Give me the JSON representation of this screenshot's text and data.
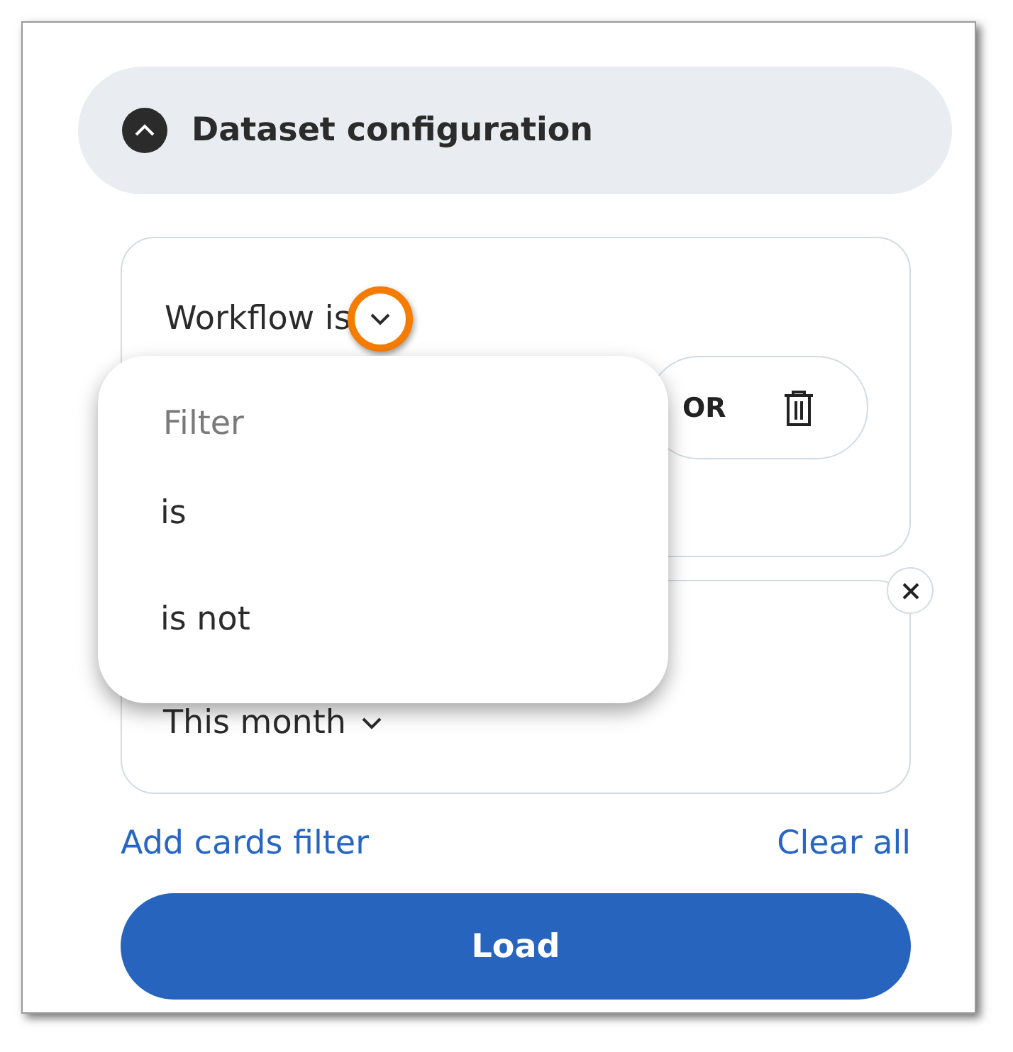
{
  "section": {
    "title": "Dataset configuration",
    "expanded": true
  },
  "filters": [
    {
      "kind": "condition",
      "label": "Workflow is",
      "operator_button": "OR"
    },
    {
      "kind": "date",
      "value": "This month"
    }
  ],
  "dropdown": {
    "search": {
      "placeholder": "Filter"
    },
    "options": [
      {
        "label": "is",
        "selected": false
      },
      {
        "label": "is not",
        "selected": false
      }
    ]
  },
  "links": [
    "Add cards filter",
    "Clear all"
  ],
  "load_button": "Load"
}
